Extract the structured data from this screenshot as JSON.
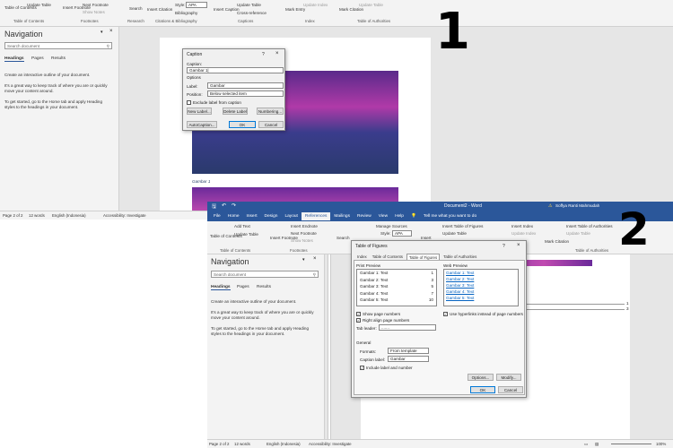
{
  "w1": {
    "ribbon": {
      "toc_label": "Table of Contents",
      "update_table": "Update Table",
      "group_toc": "Table of Contents",
      "insert_footnote": "Insert Footnote",
      "next_footnote": "Next Footnote",
      "show_notes": "Show Notes",
      "group_footnotes": "Footnotes",
      "search": "Search",
      "group_research": "Research",
      "insert_citation": "Insert Citation",
      "style_label": "Style:",
      "style_value": "APA",
      "bibliography": "Bibliography",
      "group_citations": "Citations & Bibliography",
      "insert_caption": "Insert Caption",
      "update_table2": "Update Table",
      "cross_reference": "Cross-reference",
      "group_captions": "Captions",
      "mark_entry": "Mark Entry",
      "update_index": "Update Index",
      "group_index": "Index",
      "mark_citation": "Mark Citation",
      "update_table3": "Update Table",
      "group_toa": "Table of Authorities"
    },
    "nav": {
      "title": "Navigation",
      "search_placeholder": "Search document",
      "tabs": [
        "Headings",
        "Pages",
        "Results"
      ],
      "help1": "Create an interactive outline of your document.",
      "help2": "It's a great way to keep track of where you are or quickly move your content around.",
      "help3": "To get started, go to the Home tab and apply Heading styles to the headings in your document."
    },
    "status": {
      "page": "Page 2 of 2",
      "words": "12 words",
      "language": "English (Indonesia)",
      "accessibility": "Accessibility: Investigate"
    },
    "doc": {
      "caption_text": "Gambar 1"
    },
    "caption_dialog": {
      "title": "Caption",
      "help": "?",
      "caption_label": "Caption:",
      "caption_value": "Gambar 1|",
      "options_label": "Options",
      "label_label": "Label:",
      "label_value": "Gambar",
      "position_label": "Position:",
      "position_value": "Below selected item",
      "exclude_label": "Exclude label from caption",
      "new_label": "New Label...",
      "delete_label": "Delete Label",
      "numbering": "Numbering...",
      "autocaption": "AutoCaption...",
      "ok": "OK",
      "cancel": "Cancel"
    },
    "marker": "1"
  },
  "w2": {
    "titlebar": {
      "title": "Document2 - Word",
      "user": "Soffya Ranti Mahmudah"
    },
    "tabs": [
      "File",
      "Home",
      "Insert",
      "Design",
      "Layout",
      "References",
      "Mailings",
      "Review",
      "View",
      "Help"
    ],
    "active_tab": "References",
    "tell_me": "Tell me what you want to do",
    "ribbon": {
      "add_text": "Add Text",
      "update_table": "Update Table",
      "toc_label": "Table of Contents",
      "group_toc": "Table of Contents",
      "insert_endnote": "Insert Endnote",
      "next_footnote": "Next Footnote",
      "show_notes": "Show Notes",
      "insert_footnote": "Insert Footnote",
      "group_footnotes": "Footnotes",
      "search": "Search",
      "manage_sources": "Manage Sources",
      "style_label": "Style:",
      "style_value": "APA",
      "insert": "Insert",
      "insert_tof": "Insert Table of Figures",
      "update_table2": "Update Table",
      "insert_index": "Insert Index",
      "update_index": "Update Index",
      "mark_citation": "Mark Citation",
      "insert_toa": "Insert Table of Authorities",
      "update_table3": "Update Table",
      "group_toa": "Table of Authorities"
    },
    "nav": {
      "title": "Navigation",
      "search_placeholder": "Search document",
      "tabs": [
        "Headings",
        "Pages",
        "Results"
      ],
      "help1": "Create an interactive outline of your document.",
      "help2": "It's a great way to keep track of where you are or quickly move your content around.",
      "help3": "To get started, go to the Home tab and apply Heading styles to the headings in your document."
    },
    "status": {
      "page": "Page 2 of 2",
      "words": "12 words",
      "language": "English (Indonesia)",
      "accessibility": "Accessibility: Investigate",
      "zoom": "100%"
    },
    "tof_dialog": {
      "title": "Table of Figures",
      "help": "?",
      "tabs": [
        "Index",
        "Table of Contents",
        "Table of Figures",
        "Table of Authorities"
      ],
      "print_preview_label": "Print Preview",
      "print_items": [
        {
          "text": "Gambar 1: Text",
          "page": "1"
        },
        {
          "text": "Gambar 2: Text",
          "page": "3"
        },
        {
          "text": "Gambar 3: Text",
          "page": "5"
        },
        {
          "text": "Gambar 4: Text",
          "page": "7"
        },
        {
          "text": "Gambar 5: Text",
          "page": "10"
        }
      ],
      "web_preview_label": "Web Preview",
      "web_items": [
        "Gambar 1: Text",
        "Gambar 2: Text",
        "Gambar 3: Text",
        "Gambar 4: Text",
        "Gambar 5: Text"
      ],
      "show_page_numbers": "Show page numbers",
      "right_align": "Right align page numbers",
      "tab_leader_label": "Tab leader:",
      "tab_leader_value": ".......",
      "use_hyperlinks": "Use hyperlinks instead of page numbers",
      "general_label": "General",
      "formats_label": "Formats:",
      "formats_value": "From template",
      "caption_label_label": "Caption label:",
      "caption_label_value": "Gambar",
      "include_label": "Include label and number",
      "options": "Options...",
      "modify": "Modify...",
      "ok": "OK",
      "cancel": "Cancel"
    },
    "marker": "2",
    "doc_page_numbers": [
      "1",
      "3"
    ]
  },
  "colors": {
    "word_blue": "#2b579a",
    "accent": "#0078d7",
    "link": "#0563c1"
  }
}
